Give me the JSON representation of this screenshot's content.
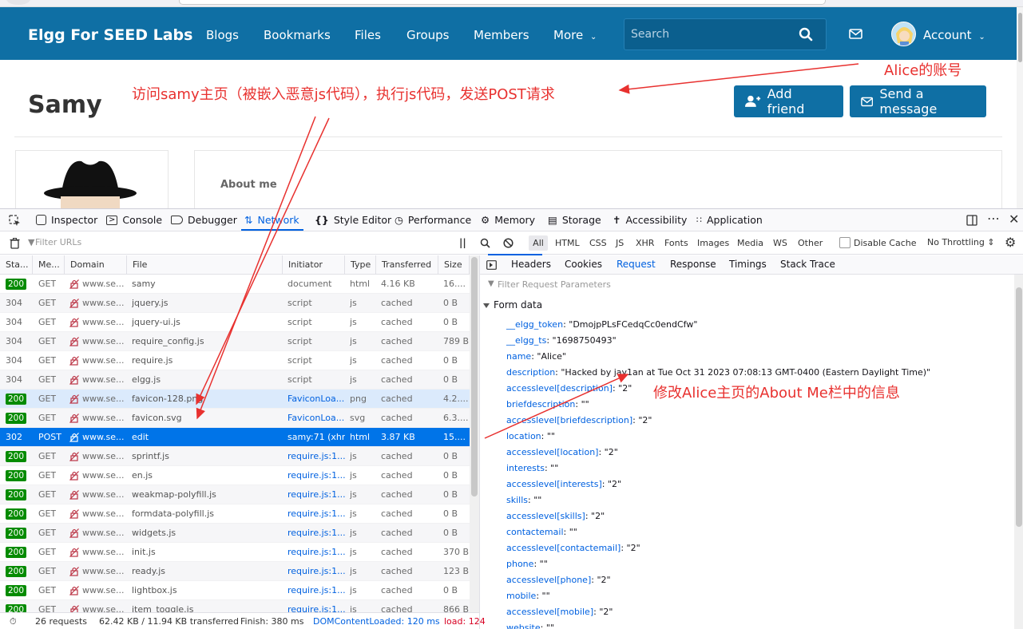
{
  "site": {
    "brand": "Elgg For SEED Labs",
    "nav": [
      "Blogs",
      "Bookmarks",
      "Files",
      "Groups",
      "Members",
      "More"
    ],
    "search_placeholder": "Search",
    "account": "Account"
  },
  "profile": {
    "name": "Samy",
    "add_friend": "Add friend",
    "send_message": "Send a message",
    "about_me": "About me"
  },
  "devtools": {
    "tabs": [
      "Inspector",
      "Console",
      "Debugger",
      "Network",
      "Style Editor",
      "Performance",
      "Memory",
      "Storage",
      "Accessibility",
      "Application"
    ],
    "filter_placeholder": "Filter URLs",
    "type_filters": [
      "All",
      "HTML",
      "CSS",
      "JS",
      "XHR",
      "Fonts",
      "Images",
      "Media",
      "WS",
      "Other"
    ],
    "disable_cache": "Disable Cache",
    "throttling": "No Throttling",
    "columns": [
      "Sta...",
      "Me...",
      "Domain",
      "File",
      "Initiator",
      "Type",
      "Transferred",
      "Size"
    ],
    "requests": [
      {
        "status": "200",
        "method": "GET",
        "domain": "www.se...",
        "file": "samy",
        "initiator": "document",
        "type": "html",
        "transferred": "4.16 KB",
        "size": "16...."
      },
      {
        "status": "304",
        "method": "GET",
        "domain": "www.se...",
        "file": "jquery.js",
        "initiator": "script",
        "type": "js",
        "transferred": "cached",
        "size": "0 B"
      },
      {
        "status": "304",
        "method": "GET",
        "domain": "www.se...",
        "file": "jquery-ui.js",
        "initiator": "script",
        "type": "js",
        "transferred": "cached",
        "size": "0 B"
      },
      {
        "status": "304",
        "method": "GET",
        "domain": "www.se...",
        "file": "require_config.js",
        "initiator": "script",
        "type": "js",
        "transferred": "cached",
        "size": "789 B"
      },
      {
        "status": "304",
        "method": "GET",
        "domain": "www.se...",
        "file": "require.js",
        "initiator": "script",
        "type": "js",
        "transferred": "cached",
        "size": "0 B"
      },
      {
        "status": "304",
        "method": "GET",
        "domain": "www.se...",
        "file": "elgg.js",
        "initiator": "script",
        "type": "js",
        "transferred": "cached",
        "size": "0 B"
      },
      {
        "status": "200",
        "method": "GET",
        "domain": "www.se...",
        "file": "favicon-128.png",
        "initiator": "FaviconLoa...",
        "type": "png",
        "transferred": "cached",
        "size": "4.2...."
      },
      {
        "status": "200",
        "method": "GET",
        "domain": "www.se...",
        "file": "favicon.svg",
        "initiator": "FaviconLoa...",
        "type": "svg",
        "transferred": "cached",
        "size": "6.3...."
      },
      {
        "status": "302",
        "method": "POST",
        "domain": "www.se...",
        "file": "edit",
        "initiator": "samy:71 (xhr)",
        "type": "html",
        "transferred": "3.87 KB",
        "size": "15...."
      },
      {
        "status": "200",
        "method": "GET",
        "domain": "www.se...",
        "file": "sprintf.js",
        "initiator": "require.js:1...",
        "type": "js",
        "transferred": "cached",
        "size": "0 B"
      },
      {
        "status": "200",
        "method": "GET",
        "domain": "www.se...",
        "file": "en.js",
        "initiator": "require.js:1...",
        "type": "js",
        "transferred": "cached",
        "size": "0 B"
      },
      {
        "status": "200",
        "method": "GET",
        "domain": "www.se...",
        "file": "weakmap-polyfill.js",
        "initiator": "require.js:1...",
        "type": "js",
        "transferred": "cached",
        "size": "0 B"
      },
      {
        "status": "200",
        "method": "GET",
        "domain": "www.se...",
        "file": "formdata-polyfill.js",
        "initiator": "require.js:1...",
        "type": "js",
        "transferred": "cached",
        "size": "0 B"
      },
      {
        "status": "200",
        "method": "GET",
        "domain": "www.se...",
        "file": "widgets.js",
        "initiator": "require.js:1...",
        "type": "js",
        "transferred": "cached",
        "size": "0 B"
      },
      {
        "status": "200",
        "method": "GET",
        "domain": "www.se...",
        "file": "init.js",
        "initiator": "require.js:1...",
        "type": "js",
        "transferred": "cached",
        "size": "370 B"
      },
      {
        "status": "200",
        "method": "GET",
        "domain": "www.se...",
        "file": "ready.js",
        "initiator": "require.js:1...",
        "type": "js",
        "transferred": "cached",
        "size": "123 B"
      },
      {
        "status": "200",
        "method": "GET",
        "domain": "www.se...",
        "file": "lightbox.js",
        "initiator": "require.js:1...",
        "type": "js",
        "transferred": "cached",
        "size": "0 B"
      },
      {
        "status": "200",
        "method": "GET",
        "domain": "www.se...",
        "file": "item_toggle.js",
        "initiator": "require.js:1...",
        "type": "js",
        "transferred": "cached",
        "size": "866 B"
      }
    ],
    "status_bar": {
      "requests": "26 requests",
      "transferred": "62.42 KB / 11.94 KB transferred",
      "finish": "Finish: 380 ms",
      "dom_loaded": "DOMContentLoaded: 120 ms",
      "load": "load: 124"
    },
    "detail_tabs": [
      "Headers",
      "Cookies",
      "Request",
      "Response",
      "Timings",
      "Stack Trace"
    ],
    "param_filter_placeholder": "Filter Request Parameters",
    "form_data_label": "Form data",
    "form_data": [
      {
        "k": "__elgg_token",
        "v": "\"DmojpPLsFCedqCc0endCfw\""
      },
      {
        "k": "__elgg_ts",
        "v": "\"1698750493\""
      },
      {
        "k": "name",
        "v": "\"Alice\""
      },
      {
        "k": "description",
        "v": "\"Hacked by jay1an at Tue Oct 31 2023 07:08:13 GMT-0400 (Eastern Daylight Time)\""
      },
      {
        "k": "accesslevel[description]",
        "v": "\"2\""
      },
      {
        "k": "briefdescription",
        "v": "\"\""
      },
      {
        "k": "accesslevel[briefdescription]",
        "v": "\"2\""
      },
      {
        "k": "location",
        "v": "\"\""
      },
      {
        "k": "accesslevel[location]",
        "v": "\"2\""
      },
      {
        "k": "interests",
        "v": "\"\""
      },
      {
        "k": "accesslevel[interests]",
        "v": "\"2\""
      },
      {
        "k": "skills",
        "v": "\"\""
      },
      {
        "k": "accesslevel[skills]",
        "v": "\"2\""
      },
      {
        "k": "contactemail",
        "v": "\"\""
      },
      {
        "k": "accesslevel[contactemail]",
        "v": "\"2\""
      },
      {
        "k": "phone",
        "v": "\"\""
      },
      {
        "k": "accesslevel[phone]",
        "v": "\"2\""
      },
      {
        "k": "mobile",
        "v": "\"\""
      },
      {
        "k": "accesslevel[mobile]",
        "v": "\"2\""
      },
      {
        "k": "website",
        "v": "\"\""
      }
    ]
  },
  "annotations": {
    "visit_samy": "访问samy主页（被嵌入恶意js代码），执行js代码，发送POST请求",
    "alice_account": "Alice的账号",
    "modify_about": "修改Alice主页的About Me栏中的信息"
  },
  "colors": {
    "elgg_blue": "#0f6fa4",
    "annotation_red": "#e8312f",
    "selected_row": "#0074e8",
    "status_ok": "#058b00"
  }
}
